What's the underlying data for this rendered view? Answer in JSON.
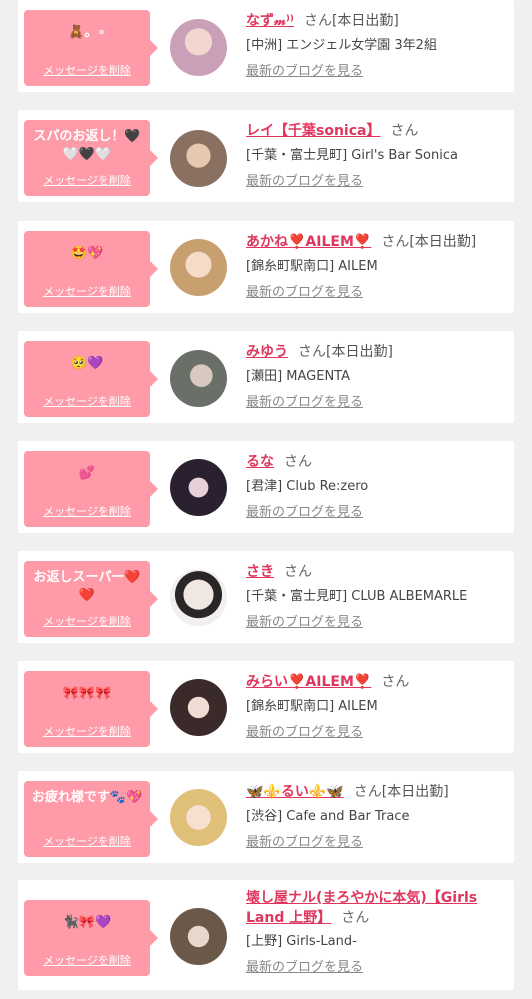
{
  "cards": [
    {
      "message": "🧸。∘",
      "delete_label": "メッセージを削除",
      "name": "なず𝓂⁾⁾",
      "san": "さん",
      "status": "[本日出勤]",
      "shop": "[中洲] エンジェル女学園 3年2組",
      "blog_label": "最新のブログを見る",
      "avatar_color": "#c9a0b8"
    },
    {
      "message": "スパのお返し！🖤🤍🖤🤍",
      "delete_label": "メッセージを削除",
      "name": "レイ【千葉sonica】",
      "san": "さん",
      "status": "",
      "shop": "[千葉・富士見町] Girl's Bar Sonica",
      "blog_label": "最新のブログを見る",
      "avatar_color": "#b09a80"
    },
    {
      "message": "🤩💖",
      "delete_label": "メッセージを削除",
      "name": "あかね❣️AILEM❣️",
      "san": "さん",
      "status": "[本日出勤]",
      "shop": "[錦糸町駅南口] AILEM",
      "blog_label": "最新のブログを見る",
      "avatar_color": "#d8b898"
    },
    {
      "message": "🥺💜",
      "delete_label": "メッセージを削除",
      "name": "みゆう",
      "san": "さん",
      "status": "[本日出勤]",
      "shop": "[瀬田] MAGENTA",
      "blog_label": "最新のブログを見る",
      "avatar_color": "#8a9088"
    },
    {
      "message": "💕",
      "delete_label": "メッセージを削除",
      "name": "るな",
      "san": "さん",
      "status": "",
      "shop": "[君津] Club Re:zero",
      "blog_label": "最新のブログを見る",
      "avatar_color": "#3a3040"
    },
    {
      "message": "お返しスーパー❤️❤️",
      "delete_label": "メッセージを削除",
      "name": "さき",
      "san": "さん",
      "status": "",
      "shop": "[千葉・富士見町] CLUB ALBEMARLE",
      "blog_label": "最新のブログを見る",
      "avatar_color": "#e8e4e0"
    },
    {
      "message": "🎀🎀🎀",
      "delete_label": "メッセージを削除",
      "name": "みらい❣️AILEM❣️",
      "san": "さん",
      "status": "",
      "shop": "[錦糸町駅南口] AILEM",
      "blog_label": "最新のブログを見る",
      "avatar_color": "#4a3a3a"
    },
    {
      "message": "お疲れ様です🐾💖",
      "delete_label": "メッセージを削除",
      "name": "🦋⚜️るい⚜️🦋",
      "san": "さん",
      "status": "[本日出勤]",
      "shop": "[渋谷] Cafe and Bar Trace",
      "blog_label": "最新のブログを見る",
      "avatar_color": "#e8d090"
    },
    {
      "message": "🐈‍⬛🎀💜",
      "delete_label": "メッセージを削除",
      "name": "壊し屋ナル(まろやかに本気)【Girls Land 上野】",
      "san": "さん",
      "status": "",
      "shop": "[上野] Girls-Land-",
      "blog_label": "最新のブログを見る",
      "avatar_color": "#706050"
    }
  ]
}
